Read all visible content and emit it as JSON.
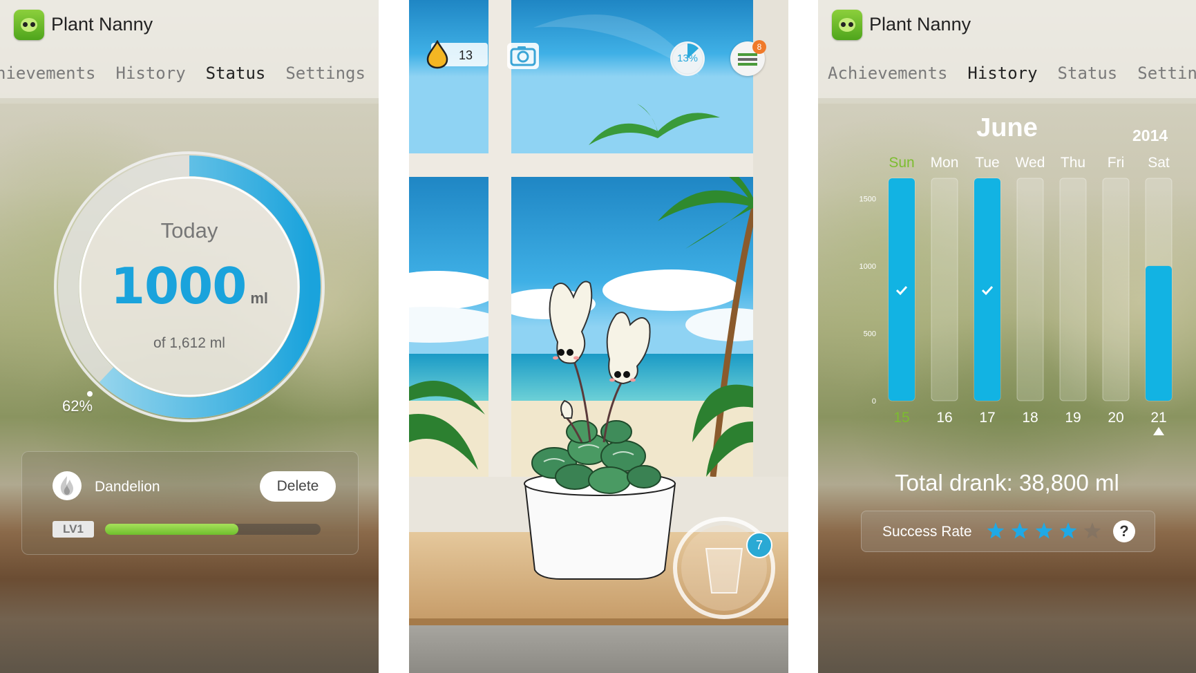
{
  "app": {
    "title": "Plant Nanny"
  },
  "status_screen": {
    "tabs": [
      {
        "label": "hievements",
        "active": false
      },
      {
        "label": "History",
        "active": false
      },
      {
        "label": "Status",
        "active": true
      },
      {
        "label": "Settings",
        "active": false
      }
    ],
    "today_label": "Today",
    "amount": "1000",
    "unit": "ml",
    "goal_text": "of 1,612 ml",
    "percent_label": "62%",
    "progress": 0.62,
    "plant": {
      "name": "Dandelion",
      "delete_label": "Delete",
      "level": "LV1",
      "level_progress": 0.62
    },
    "ring_color": "#1aa3dc"
  },
  "garden_screen": {
    "water_drops": "13",
    "completion": "13%",
    "menu_badge": "8",
    "glass_badge": "7",
    "icons": [
      "water-drop-icon",
      "camera-icon",
      "menu-icon",
      "water-glass-icon"
    ]
  },
  "history_screen": {
    "tabs": [
      {
        "label": "Achievements",
        "active": false
      },
      {
        "label": "History",
        "active": true
      },
      {
        "label": "Status",
        "active": false
      },
      {
        "label": "Settin",
        "active": false
      }
    ],
    "month": "June",
    "year": "2014",
    "chart_data": {
      "type": "bar",
      "categories": [
        "Sun",
        "Mon",
        "Tue",
        "Wed",
        "Thu",
        "Fri",
        "Sat"
      ],
      "dates": [
        "15",
        "16",
        "17",
        "18",
        "19",
        "20",
        "21"
      ],
      "values": [
        1650,
        0,
        1650,
        0,
        0,
        0,
        1000
      ],
      "goal_met": [
        true,
        false,
        true,
        false,
        false,
        false,
        false
      ],
      "yticks": [
        "0",
        "500",
        "1000",
        "1500"
      ],
      "ylim": [
        0,
        1650
      ],
      "bar_color": "#12b3e3",
      "highlight_day_color": "#7cbd2f",
      "selected_index": 6
    },
    "total_text": "Total drank: 38,800 ml",
    "success_label": "Success Rate",
    "stars_filled": 4,
    "stars_total": 5,
    "help_label": "?"
  }
}
